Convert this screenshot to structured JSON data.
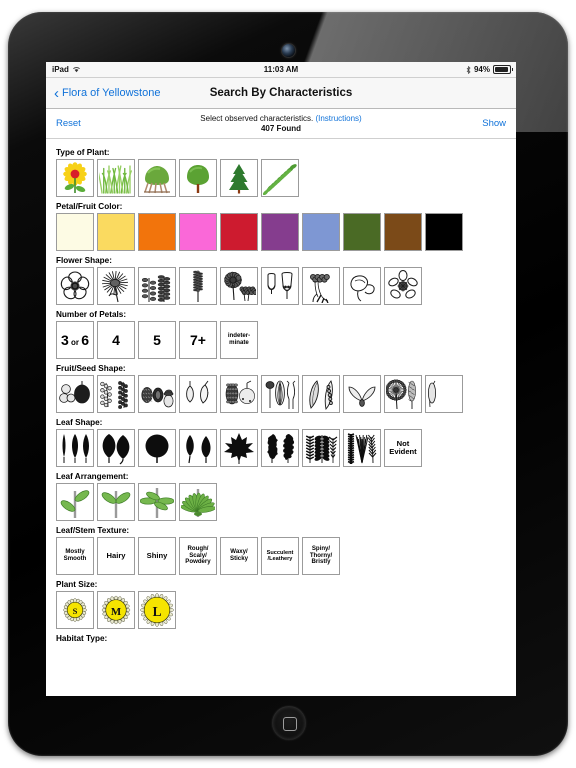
{
  "device": {
    "name": "ipad",
    "camera": "front-camera",
    "home_button": "home-button"
  },
  "status_bar": {
    "carrier": "iPad",
    "wifi_icon": "wifi-icon",
    "time": "11:03 AM",
    "bluetooth_icon": "bluetooth-icon",
    "battery_percent": "94%",
    "battery_icon": "battery-icon"
  },
  "nav_bar": {
    "back_icon": "chevron-left-icon",
    "back_label": "Flora of Yellowstone",
    "title": "Search By Characteristics"
  },
  "sub_bar": {
    "reset_label": "Reset",
    "prompt": "Select observed characteristics.",
    "instructions_label": "(Instructions)",
    "found_label": "407 Found",
    "show_label": "Show"
  },
  "sections": [
    {
      "id": "type-of-plant",
      "label": "Type of Plant:",
      "kind": "icons",
      "items": [
        {
          "icon": "sunflower-wildflower-icon",
          "alt": "Wildflower"
        },
        {
          "icon": "grass-icon",
          "alt": "Grass"
        },
        {
          "icon": "shrub-icon",
          "alt": "Shrub"
        },
        {
          "icon": "deciduous-tree-icon",
          "alt": "Deciduous Tree"
        },
        {
          "icon": "conifer-tree-icon",
          "alt": "Conifer"
        },
        {
          "icon": "fern-icon",
          "alt": "Fern"
        }
      ]
    },
    {
      "id": "petal-fruit-color",
      "label": "Petal/Fruit Color:",
      "kind": "colors",
      "items": [
        {
          "icon": "color-swatch-white",
          "hex": "#fdfbe4",
          "alt": "White"
        },
        {
          "icon": "color-swatch-yellow",
          "hex": "#fada60",
          "alt": "Yellow"
        },
        {
          "icon": "color-swatch-orange",
          "hex": "#f2740c",
          "alt": "Orange"
        },
        {
          "icon": "color-swatch-pink",
          "hex": "#fa68d8",
          "alt": "Pink"
        },
        {
          "icon": "color-swatch-red",
          "hex": "#cd1b2f",
          "alt": "Red"
        },
        {
          "icon": "color-swatch-purple",
          "hex": "#853d8e",
          "alt": "Purple"
        },
        {
          "icon": "color-swatch-blue",
          "hex": "#7e97d3",
          "alt": "Blue"
        },
        {
          "icon": "color-swatch-green",
          "hex": "#4a6a25",
          "alt": "Green"
        },
        {
          "icon": "color-swatch-brown",
          "hex": "#7b4a18",
          "alt": "Brown"
        },
        {
          "icon": "color-swatch-black",
          "hex": "#000000",
          "alt": "Black"
        }
      ]
    },
    {
      "id": "flower-shape",
      "label": "Flower Shape:",
      "kind": "icons",
      "items": [
        {
          "icon": "flower-radial-5petal-icon",
          "alt": "Radial 5-petal"
        },
        {
          "icon": "flower-composite-daisy-icon",
          "alt": "Composite / daisy"
        },
        {
          "icon": "flower-spike-raceme-icon",
          "alt": "Spike / raceme"
        },
        {
          "icon": "flower-catkin-icon",
          "alt": "Catkin"
        },
        {
          "icon": "flower-umbel-cluster-icon",
          "alt": "Umbel / cluster"
        },
        {
          "icon": "flower-bell-icon",
          "alt": "Bell shaped"
        },
        {
          "icon": "flower-tubular-icon",
          "alt": "Tubular"
        },
        {
          "icon": "flower-irregular-pea-icon",
          "alt": "Irregular / pea"
        },
        {
          "icon": "flower-orchid-icon",
          "alt": "Orchid like"
        }
      ]
    },
    {
      "id": "number-of-petals",
      "label": "Number of Petals:",
      "kind": "text",
      "items": [
        {
          "icon": "petals-3-or-6",
          "text": "3 or 6",
          "style": "num-or"
        },
        {
          "icon": "petals-4",
          "text": "4",
          "style": "num"
        },
        {
          "icon": "petals-5",
          "text": "5",
          "style": "num"
        },
        {
          "icon": "petals-7plus",
          "text": "7+",
          "style": "num"
        },
        {
          "icon": "petals-indeterminate",
          "text": "indeter-\nminate",
          "style": "small"
        }
      ]
    },
    {
      "id": "fruit-seed-shape",
      "label": "Fruit/Seed Shape:",
      "kind": "icons",
      "items": [
        {
          "icon": "fruit-berry-icon",
          "alt": "Berry"
        },
        {
          "icon": "fruit-berry-cluster-icon",
          "alt": "Berry cluster"
        },
        {
          "icon": "fruit-nut-acorn-icon",
          "alt": "Nut / acorn"
        },
        {
          "icon": "fruit-capsule-icon",
          "alt": "Capsule"
        },
        {
          "icon": "fruit-cone-apple-icon",
          "alt": "Cone / pome"
        },
        {
          "icon": "fruit-seedhead-icon",
          "alt": "Seed head"
        },
        {
          "icon": "fruit-pod-icon",
          "alt": "Pod"
        },
        {
          "icon": "fruit-winged-samara-icon",
          "alt": "Winged samara"
        },
        {
          "icon": "fruit-tufted-seed-icon",
          "alt": "Tufted seed"
        },
        {
          "icon": "fruit-partial-offscreen-icon",
          "alt": "More (scrolled)"
        }
      ]
    },
    {
      "id": "leaf-shape",
      "label": "Leaf Shape:",
      "kind": "icons",
      "items": [
        {
          "icon": "leaf-linear-lanceolate-icon",
          "alt": "Linear / lanceolate"
        },
        {
          "icon": "leaf-ovate-heart-icon",
          "alt": "Ovate / heart"
        },
        {
          "icon": "leaf-round-icon",
          "alt": "Round"
        },
        {
          "icon": "leaf-spatulate-icon",
          "alt": "Spatulate"
        },
        {
          "icon": "leaf-maple-lobed-icon",
          "alt": "Maple / lobed"
        },
        {
          "icon": "leaf-oak-toothed-icon",
          "alt": "Oak / toothed"
        },
        {
          "icon": "leaf-compound-pinnate-icon",
          "alt": "Compound pinnate"
        },
        {
          "icon": "leaf-needle-icon",
          "alt": "Needle / scale"
        },
        {
          "icon": "leaf-not-evident",
          "text": "Not\nEvident",
          "style": "text"
        }
      ]
    },
    {
      "id": "leaf-arrangement",
      "label": "Leaf Arrangement:",
      "kind": "icons",
      "items": [
        {
          "icon": "leaf-arrangement-alternate-icon",
          "alt": "Alternate"
        },
        {
          "icon": "leaf-arrangement-opposite-icon",
          "alt": "Opposite"
        },
        {
          "icon": "leaf-arrangement-whorled-icon",
          "alt": "Whorled"
        },
        {
          "icon": "leaf-arrangement-basal-icon",
          "alt": "Basal rosette"
        }
      ]
    },
    {
      "id": "leaf-stem-texture",
      "label": "Leaf/Stem Texture:",
      "kind": "text",
      "items": [
        {
          "icon": "texture-mostly-smooth",
          "text": "Mostly\nSmooth",
          "style": "small"
        },
        {
          "icon": "texture-hairy",
          "text": "Hairy",
          "style": "text"
        },
        {
          "icon": "texture-shiny",
          "text": "Shiny",
          "style": "text"
        },
        {
          "icon": "texture-rough-scaly-powdery",
          "text": "Rough/\nScaly/\nPowdery",
          "style": "small"
        },
        {
          "icon": "texture-waxy-sticky",
          "text": "Waxy/\nSticky",
          "style": "small"
        },
        {
          "icon": "texture-succulent-leathery",
          "text": "Succulent\n/Leathery",
          "style": "tiny"
        },
        {
          "icon": "texture-spiny-thorny-bristly",
          "text": "Spiny/\nThorny/\nBristly",
          "style": "small"
        }
      ]
    },
    {
      "id": "plant-size",
      "label": "Plant Size:",
      "kind": "icons",
      "items": [
        {
          "icon": "plant-size-small-icon",
          "alt": "Small",
          "letter": "S"
        },
        {
          "icon": "plant-size-medium-icon",
          "alt": "Medium",
          "letter": "M"
        },
        {
          "icon": "plant-size-large-icon",
          "alt": "Large",
          "letter": "L"
        }
      ]
    },
    {
      "id": "habitat-type",
      "label": "Habitat Type:",
      "kind": "label-only",
      "items": []
    }
  ]
}
